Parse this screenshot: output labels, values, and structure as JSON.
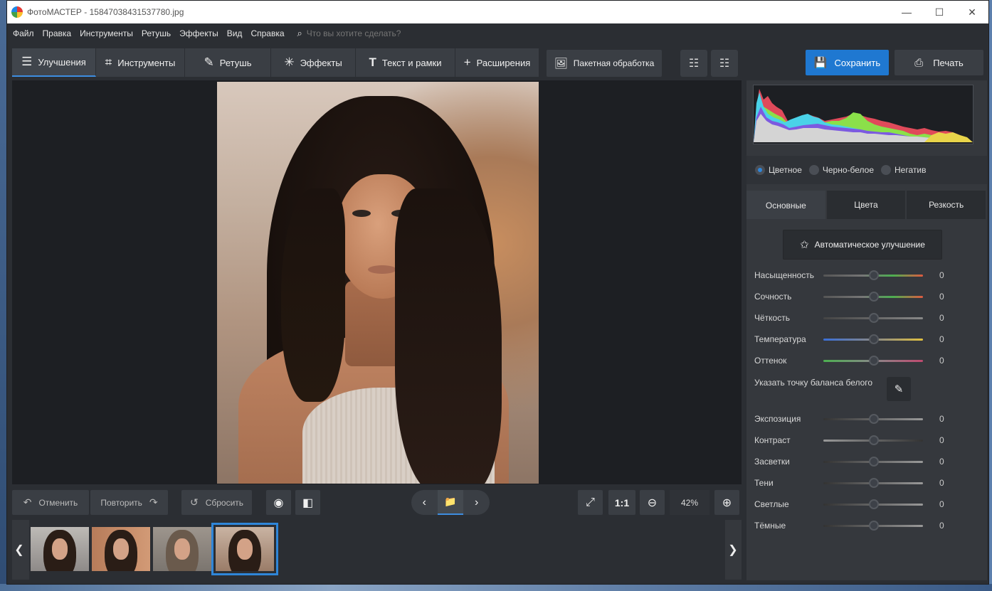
{
  "titlebar": {
    "app": "ФотоМАСТЕР",
    "separator": " - ",
    "file": "15847038431537780.jpg",
    "minimize": "—",
    "maximize": "☐",
    "close": "✕"
  },
  "menu": {
    "items": [
      "Файл",
      "Правка",
      "Инструменты",
      "Ретушь",
      "Эффекты",
      "Вид",
      "Справка"
    ],
    "search_placeholder": "Что вы хотите сделать?"
  },
  "toolbar": {
    "tabs": [
      {
        "label": "Улучшения",
        "icon": "sliders-icon"
      },
      {
        "label": "Инструменты",
        "icon": "crop-icon"
      },
      {
        "label": "Ретушь",
        "icon": "brush-icon"
      },
      {
        "label": "Эффекты",
        "icon": "magic-wand-icon"
      },
      {
        "label": "Текст и рамки",
        "icon": "text-icon"
      },
      {
        "label": "Расширения",
        "icon": "plus-icon"
      }
    ],
    "batch_label": "Пакетная обработка",
    "save_label": "Сохранить",
    "print_label": "Печать"
  },
  "bottom": {
    "undo": "Отменить",
    "redo": "Повторить",
    "reset": "Сбросить",
    "one_to_one": "1:1",
    "zoom": "42%"
  },
  "right": {
    "modes": [
      "Цветное",
      "Черно-белое",
      "Негатив"
    ],
    "tabs": [
      "Основные",
      "Цвета",
      "Резкость"
    ],
    "auto_label": "Автоматическое улучшение",
    "sliders_a": [
      {
        "label": "Насыщенность",
        "value": "0"
      },
      {
        "label": "Сочность",
        "value": "0"
      },
      {
        "label": "Чёткость",
        "value": "0"
      },
      {
        "label": "Температура",
        "value": "0"
      },
      {
        "label": "Оттенок",
        "value": "0"
      }
    ],
    "wb_label": "Указать точку баланса белого",
    "sliders_b": [
      {
        "label": "Экспозиция",
        "value": "0"
      },
      {
        "label": "Контраст",
        "value": "0"
      },
      {
        "label": "Засветки",
        "value": "0"
      },
      {
        "label": "Тени",
        "value": "0"
      },
      {
        "label": "Светлые",
        "value": "0"
      },
      {
        "label": "Тёмные",
        "value": "0"
      }
    ]
  },
  "colors": {
    "accent": "#1f78d1",
    "selection": "#2f86d9"
  }
}
